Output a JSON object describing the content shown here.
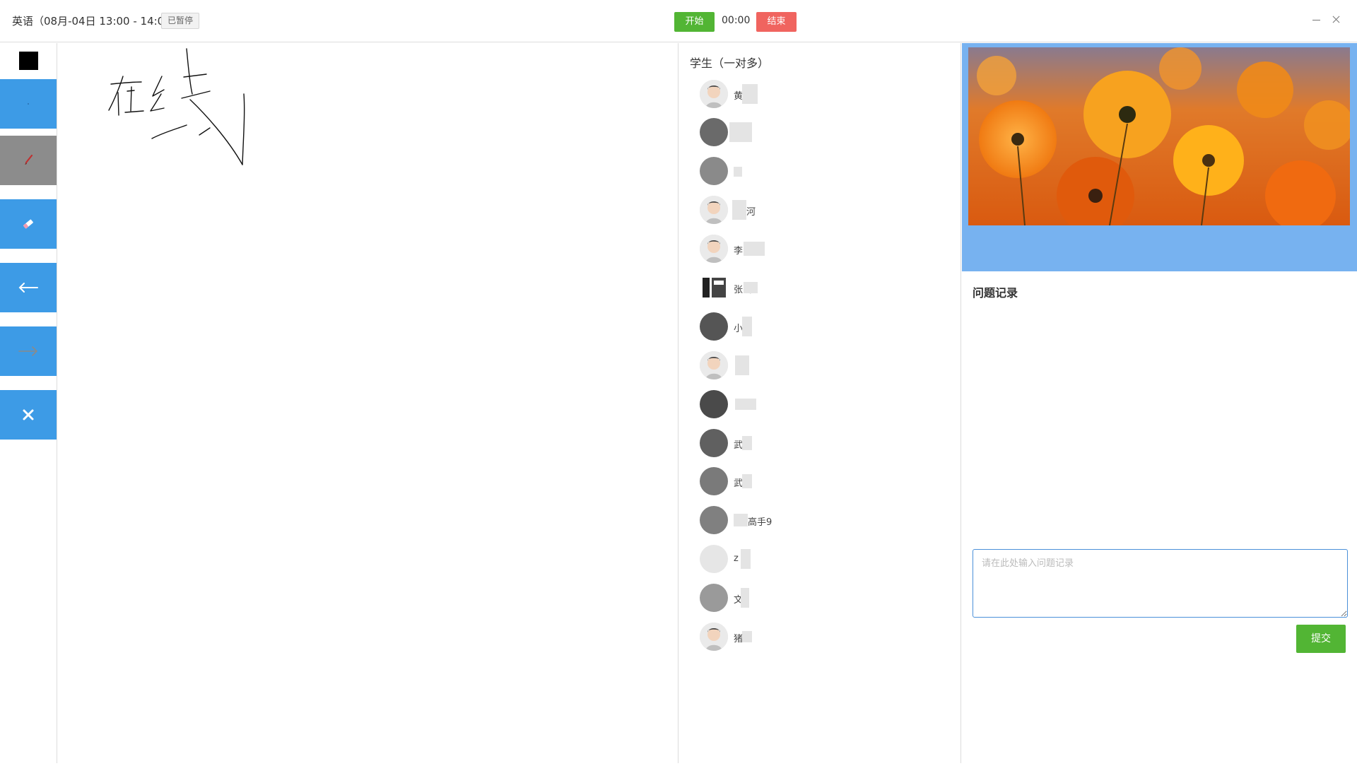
{
  "header": {
    "course_title": "英语（08月-04日 13:00 - 14:00）",
    "status_badge": "已暂停",
    "start_label": "开始",
    "timer": "00:00",
    "end_label": "结束"
  },
  "toolbar": {
    "current_color": "#000000",
    "tools": [
      {
        "name": "pen",
        "icon": "pen-icon"
      },
      {
        "name": "brush",
        "icon": "brush-icon",
        "active": true
      },
      {
        "name": "eraser",
        "icon": "eraser-icon"
      },
      {
        "name": "undo",
        "icon": "arrow-left-icon"
      },
      {
        "name": "redo",
        "icon": "arrow-right-icon"
      },
      {
        "name": "clear",
        "icon": "close-icon"
      }
    ]
  },
  "whiteboard": {
    "handwriting": "在线"
  },
  "students": {
    "title": "学生（一对多）",
    "items": [
      {
        "name": "黄",
        "avatar": "default-boy-avatar"
      },
      {
        "name": "",
        "avatar": "photo-avatar"
      },
      {
        "name": "",
        "avatar": "photo-avatar"
      },
      {
        "name": "河",
        "avatar": "default-boy-avatar"
      },
      {
        "name": "李",
        "avatar": "default-boy-avatar"
      },
      {
        "name": "张 耀",
        "avatar": "logo-avatar"
      },
      {
        "name": "小",
        "avatar": "photo-avatar"
      },
      {
        "name": "",
        "avatar": "default-boy-avatar"
      },
      {
        "name": "",
        "avatar": "photo-avatar"
      },
      {
        "name": "武 6",
        "avatar": "photo-avatar"
      },
      {
        "name": "武 7",
        "avatar": "photo-avatar"
      },
      {
        "name": "高手9",
        "avatar": "photo-avatar"
      },
      {
        "name": "z",
        "avatar": "photo-avatar"
      },
      {
        "name": "文",
        "avatar": "photo-avatar"
      },
      {
        "name": "猪",
        "avatar": "default-boy-avatar"
      }
    ]
  },
  "notes": {
    "title": "问题记录",
    "placeholder": "请在此处输入问题记录",
    "submit_label": "提交"
  },
  "colors": {
    "accent_blue": "#3d9be6",
    "start_green": "#52b534",
    "end_red": "#f0645f",
    "video_bg": "#77b2f0"
  }
}
